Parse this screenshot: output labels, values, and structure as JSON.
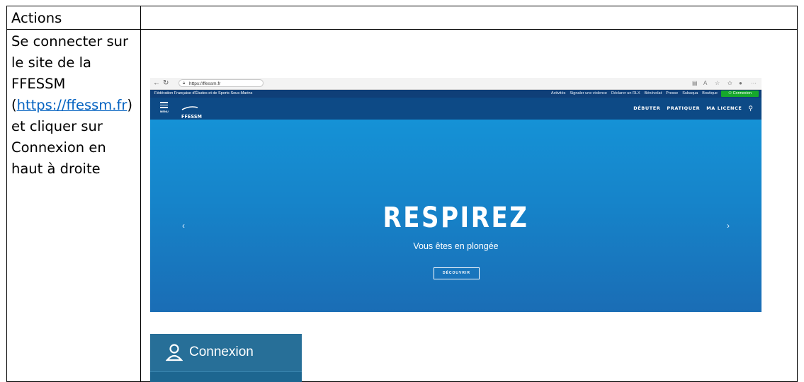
{
  "table": {
    "header": "Actions",
    "step_text_before_link": "Se connecter sur le site de la FFESSM (",
    "step_link": "https://ffessm.fr",
    "step_text_after_link": ") et cliquer sur Connexion en haut à droite"
  },
  "site": {
    "url": "https://ffessm.fr",
    "federation_name": "Fédération Française d'Études et de Sports Sous-Marins",
    "top_links": [
      "Activités",
      "Signaler une violence",
      "Déclarer un RLX",
      "Bénévolat",
      "Presse",
      "Subaqua",
      "Boutique"
    ],
    "connexion": "Connexion",
    "menu_label": "MENU",
    "logo": "FFESSM",
    "nav": [
      "DÉBUTER",
      "PRATIQUER",
      "MA LICENCE"
    ],
    "hero_title": "RESPIREZ",
    "hero_subtitle": "Vous êtes en plongée",
    "hero_button": "DÉCOUVRIR"
  },
  "zoom": {
    "label": "Connexion"
  },
  "colors": {
    "link": "#0563c1",
    "site_top_bar": "#0f3f78",
    "site_nav": "#0d4a86",
    "hero": "#1683c9",
    "connexion_green": "#16a82c"
  }
}
